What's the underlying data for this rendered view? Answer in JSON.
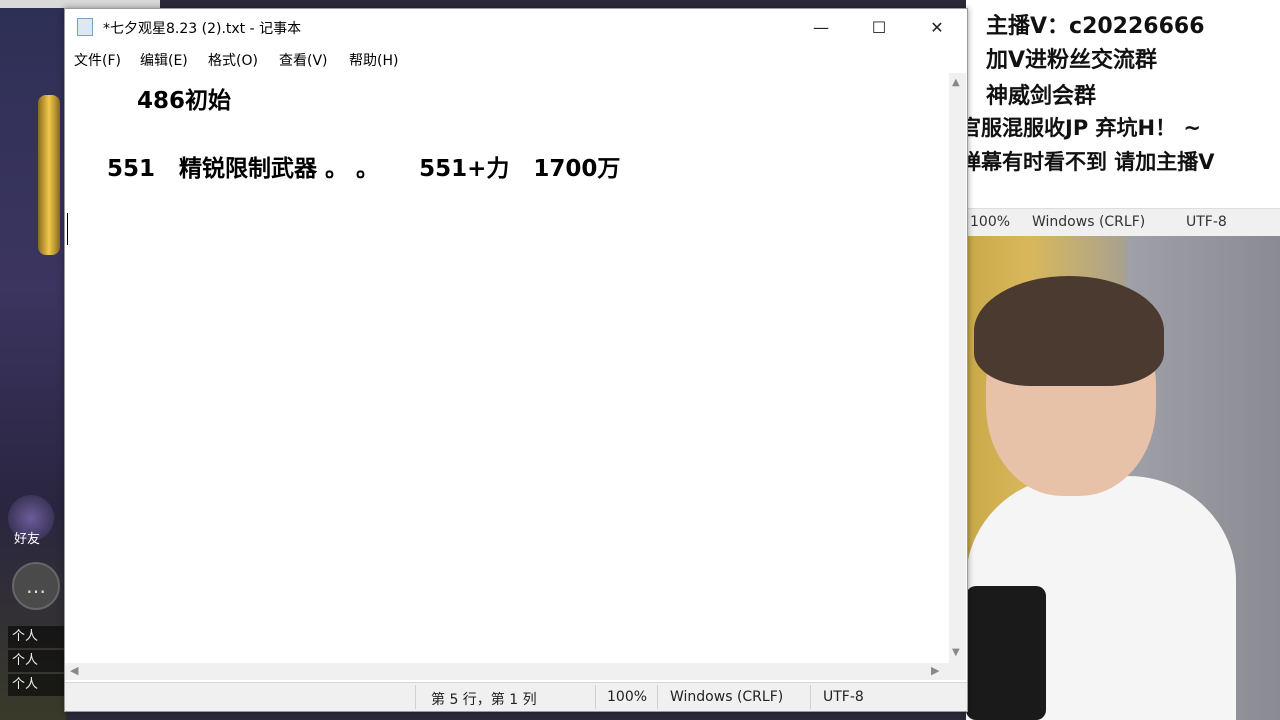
{
  "window": {
    "title": "*七夕观星8.23 (2).txt - 记事本",
    "minimize_glyph": "—",
    "maximize_glyph": "☐",
    "close_glyph": "✕"
  },
  "menu": [
    "文件(F)",
    "编辑(E)",
    "格式(O)",
    "查看(V)",
    "帮助(H)"
  ],
  "editor": {
    "lines": [
      "486初始",
      "551   精锐限制武器 。 。     551+力   1700万"
    ]
  },
  "status": {
    "position": "第 5 行，第 1 列",
    "zoom": "100%",
    "line_ending": "Windows (CRLF)",
    "encoding": "UTF-8"
  },
  "overlay": {
    "lines": [
      "主播V：c20226666",
      "加V进粉丝交流群",
      "神威剑会群",
      "官服混服收JP     弃坑H！ ~",
      "弹幕有时看不到 请加主播V"
    ],
    "status": {
      "zoom": "100%",
      "line_ending": "Windows (CRLF)",
      "encoding": "UTF-8"
    }
  },
  "game": {
    "friend_label": "好友",
    "side_messages": [
      "个人",
      "个人",
      "个人"
    ]
  }
}
